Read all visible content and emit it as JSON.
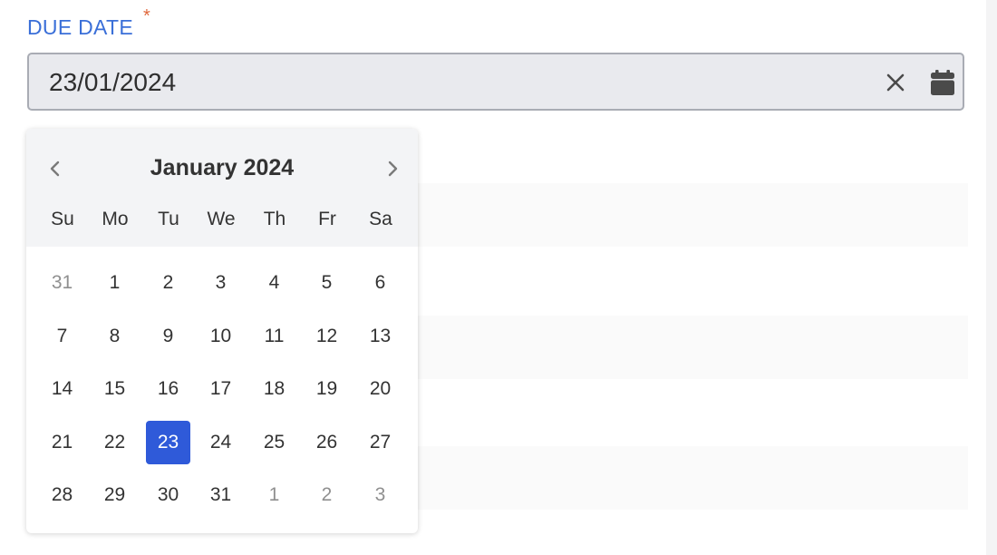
{
  "field": {
    "label": "DUE DATE",
    "required_marker": "*",
    "value": "23/01/2024",
    "clear_icon": "close-icon",
    "calendar_icon": "calendar-icon"
  },
  "calendar": {
    "month_title": "January 2024",
    "prev_icon": "chevron-left-icon",
    "next_icon": "chevron-right-icon",
    "weekdays": [
      "Su",
      "Mo",
      "Tu",
      "We",
      "Th",
      "Fr",
      "Sa"
    ],
    "weeks": [
      [
        {
          "label": "31",
          "outside": true
        },
        {
          "label": "1"
        },
        {
          "label": "2"
        },
        {
          "label": "3"
        },
        {
          "label": "4"
        },
        {
          "label": "5"
        },
        {
          "label": "6"
        }
      ],
      [
        {
          "label": "7"
        },
        {
          "label": "8"
        },
        {
          "label": "9"
        },
        {
          "label": "10"
        },
        {
          "label": "11"
        },
        {
          "label": "12"
        },
        {
          "label": "13"
        }
      ],
      [
        {
          "label": "14"
        },
        {
          "label": "15"
        },
        {
          "label": "16"
        },
        {
          "label": "17"
        },
        {
          "label": "18"
        },
        {
          "label": "19"
        },
        {
          "label": "20"
        }
      ],
      [
        {
          "label": "21"
        },
        {
          "label": "22"
        },
        {
          "label": "23",
          "selected": true
        },
        {
          "label": "24"
        },
        {
          "label": "25"
        },
        {
          "label": "26"
        },
        {
          "label": "27"
        }
      ],
      [
        {
          "label": "28"
        },
        {
          "label": "29"
        },
        {
          "label": "30"
        },
        {
          "label": "31"
        },
        {
          "label": "1",
          "outside": true
        },
        {
          "label": "2",
          "outside": true
        },
        {
          "label": "3",
          "outside": true
        }
      ]
    ]
  },
  "colors": {
    "accent": "#2f5ad9",
    "label": "#3a6fd8",
    "required": "#e0683c",
    "input_bg": "#e9eaee",
    "header_bg": "#f3f4f6"
  }
}
